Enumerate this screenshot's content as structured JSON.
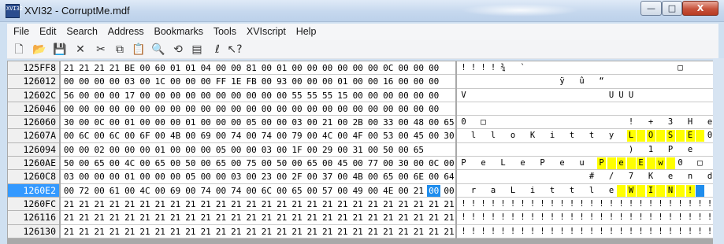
{
  "window": {
    "title": "XVI32 - CorruptMe.mdf",
    "icon_text": "XVI32",
    "minimize": "—",
    "maximize": "□",
    "close": "X"
  },
  "menu": [
    "File",
    "Edit",
    "Search",
    "Address",
    "Bookmarks",
    "Tools",
    "XVIscript",
    "Help"
  ],
  "toolbar": [
    {
      "name": "new-file-icon",
      "glyph": "🗋"
    },
    {
      "name": "open-folder-icon",
      "glyph": "📂"
    },
    {
      "name": "save-icon",
      "glyph": "💾"
    },
    {
      "name": "delete-icon",
      "glyph": "✕"
    },
    {
      "name": "cut-icon",
      "glyph": "✂"
    },
    {
      "name": "copy-icon",
      "glyph": "⧉"
    },
    {
      "name": "paste-icon",
      "glyph": "📋"
    },
    {
      "name": "find-icon",
      "glyph": "🔍"
    },
    {
      "name": "replace-icon",
      "glyph": "⟲"
    },
    {
      "name": "properties-icon",
      "glyph": "▤"
    },
    {
      "name": "script-icon",
      "glyph": "ℓ"
    },
    {
      "name": "help-pointer-icon",
      "glyph": "↖?"
    }
  ],
  "hex_view": {
    "selected_row": 9,
    "rows": [
      {
        "addr": "125FF8",
        "hex": [
          "21",
          "21",
          "21",
          "21",
          "BE",
          "00",
          "60",
          "01",
          "01",
          "04",
          "00",
          "00",
          "81",
          "00",
          "01",
          "00",
          "00",
          "00",
          "00",
          "00",
          "00",
          "0C",
          "00",
          "00",
          "00"
        ],
        "ascii": [
          "!",
          "!",
          "!",
          "!",
          "¾",
          "",
          "`",
          "",
          "",
          "",
          "",
          "",
          "",
          "",
          "",
          "",
          "",
          "",
          "",
          "",
          "",
          "",
          "□",
          "",
          ""
        ],
        "hl": []
      },
      {
        "addr": "126012",
        "hex": [
          "00",
          "00",
          "00",
          "00",
          "03",
          "00",
          "1C",
          "00",
          "00",
          "00",
          "FF",
          "1E",
          "FB",
          "00",
          "93",
          "00",
          "00",
          "00",
          "01",
          "00",
          "00",
          "16",
          "00",
          "00",
          "00"
        ],
        "ascii": [
          "",
          "",
          "",
          "",
          "",
          "",
          "",
          "",
          "",
          "",
          "ÿ",
          "",
          "û",
          "",
          "“",
          "",
          "",
          "",
          "",
          "",
          "",
          "",
          "",
          "",
          ""
        ],
        "hl": []
      },
      {
        "addr": "12602C",
        "hex": [
          "56",
          "00",
          "00",
          "00",
          "17",
          "00",
          "00",
          "00",
          "00",
          "00",
          "00",
          "00",
          "00",
          "00",
          "00",
          "55",
          "55",
          "55",
          "15",
          "00",
          "00",
          "00",
          "00",
          "00",
          "00"
        ],
        "ascii": [
          "V",
          "",
          "",
          "",
          "",
          "",
          "",
          "",
          "",
          "",
          "",
          "",
          "",
          "",
          "",
          "U",
          "U",
          "U",
          "",
          "",
          "",
          "",
          "",
          "",
          ""
        ],
        "hl": []
      },
      {
        "addr": "126046",
        "hex": [
          "00",
          "00",
          "00",
          "00",
          "00",
          "00",
          "00",
          "00",
          "00",
          "00",
          "00",
          "00",
          "00",
          "00",
          "00",
          "00",
          "00",
          "00",
          "00",
          "00",
          "00",
          "00",
          "00",
          "00",
          "00"
        ],
        "ascii": [
          "",
          "",
          "",
          "",
          "",
          "",
          "",
          "",
          "",
          "",
          "",
          "",
          "",
          "",
          "",
          "",
          "",
          "",
          "",
          "",
          "",
          "",
          "",
          "",
          ""
        ],
        "hl": []
      },
      {
        "addr": "126060",
        "hex": [
          "30",
          "00",
          "0C",
          "00",
          "01",
          "00",
          "00",
          "00",
          "01",
          "00",
          "00",
          "00",
          "05",
          "00",
          "00",
          "03",
          "00",
          "21",
          "00",
          "2B",
          "00",
          "33",
          "00",
          "48",
          "00",
          "65"
        ],
        "ascii": [
          "0",
          "",
          "□",
          "",
          "",
          "",
          "",
          "",
          "",
          "",
          "",
          "",
          "",
          "",
          "",
          "",
          "",
          "!",
          "",
          "+",
          "",
          "3",
          "",
          "H",
          "",
          "e"
        ],
        "hl": []
      },
      {
        "addr": "12607A",
        "hex": [
          "00",
          "6C",
          "00",
          "6C",
          "00",
          "6F",
          "00",
          "4B",
          "00",
          "69",
          "00",
          "74",
          "00",
          "74",
          "00",
          "79",
          "00",
          "4C",
          "00",
          "4F",
          "00",
          "53",
          "00",
          "45",
          "00",
          "30"
        ],
        "ascii": [
          "",
          "l",
          "",
          "l",
          "",
          "o",
          "",
          "K",
          "",
          "i",
          "",
          "t",
          "",
          "t",
          "",
          "y",
          "",
          "L",
          "",
          "O",
          "",
          "S",
          "",
          "E",
          "",
          "0"
        ],
        "hl": [
          17,
          18,
          19,
          20,
          21,
          22,
          23,
          24
        ]
      },
      {
        "addr": "126094",
        "hex": [
          "00",
          "00",
          "02",
          "00",
          "00",
          "00",
          "01",
          "00",
          "00",
          "00",
          "05",
          "00",
          "00",
          "03",
          "00",
          "1F",
          "00",
          "29",
          "00",
          "31",
          "00",
          "50",
          "00",
          "65"
        ],
        "ascii": [
          "",
          "",
          "",
          "",
          "",
          "",
          "",
          "",
          "",
          "",
          "",
          "",
          "",
          "",
          "",
          "",
          "",
          ")",
          "",
          "1",
          "",
          "P",
          "",
          "e"
        ],
        "hl": []
      },
      {
        "addr": "1260AE",
        "hex": [
          "50",
          "00",
          "65",
          "00",
          "4C",
          "00",
          "65",
          "00",
          "50",
          "00",
          "65",
          "00",
          "75",
          "00",
          "50",
          "00",
          "65",
          "00",
          "45",
          "00",
          "77",
          "00",
          "30",
          "00",
          "0C",
          "00"
        ],
        "ascii": [
          "P",
          "",
          "e",
          "",
          "L",
          "",
          "e",
          "",
          "P",
          "",
          "e",
          "",
          "u",
          "",
          "P",
          "",
          "e",
          "",
          "E",
          "",
          "w",
          "",
          "0",
          "",
          "□",
          ""
        ],
        "hl": [
          14,
          15,
          16,
          17,
          18,
          19,
          20,
          21
        ]
      },
      {
        "addr": "1260C8",
        "hex": [
          "03",
          "00",
          "00",
          "00",
          "01",
          "00",
          "00",
          "00",
          "05",
          "00",
          "00",
          "03",
          "00",
          "23",
          "00",
          "2F",
          "00",
          "37",
          "00",
          "4B",
          "00",
          "65",
          "00",
          "6E",
          "00",
          "64"
        ],
        "ascii": [
          "",
          "",
          "",
          "",
          "",
          "",
          "",
          "",
          "",
          "",
          "",
          "",
          "",
          "#",
          "",
          "/",
          "",
          "7",
          "",
          "K",
          "",
          "e",
          "",
          "n",
          "",
          "d"
        ],
        "hl": []
      },
      {
        "addr": "1260E2",
        "hex": [
          "00",
          "72",
          "00",
          "61",
          "00",
          "4C",
          "00",
          "69",
          "00",
          "74",
          "00",
          "74",
          "00",
          "6C",
          "00",
          "65",
          "00",
          "57",
          "00",
          "49",
          "00",
          "4E",
          "00",
          "21",
          "00",
          "00"
        ],
        "ascii": [
          "",
          "r",
          "",
          "a",
          "",
          "L",
          "",
          "i",
          "",
          "t",
          "",
          "t",
          "",
          "l",
          "",
          "e",
          "",
          "W",
          "",
          "I",
          "",
          "N",
          "",
          "!",
          "",
          ""
        ],
        "hl": [
          16,
          17,
          18,
          19,
          20,
          21,
          22,
          23,
          24
        ],
        "cursor": 24
      },
      {
        "addr": "1260FC",
        "hex": [
          "21",
          "21",
          "21",
          "21",
          "21",
          "21",
          "21",
          "21",
          "21",
          "21",
          "21",
          "21",
          "21",
          "21",
          "21",
          "21",
          "21",
          "21",
          "21",
          "21",
          "21",
          "21",
          "21",
          "21",
          "21",
          "21"
        ],
        "ascii": [
          "!",
          "!",
          "!",
          "!",
          "!",
          "!",
          "!",
          "!",
          "!",
          "!",
          "!",
          "!",
          "!",
          "!",
          "!",
          "!",
          "!",
          "!",
          "!",
          "!",
          "!",
          "!",
          "!",
          "!",
          "!",
          "!"
        ],
        "hl": []
      },
      {
        "addr": "126116",
        "hex": [
          "21",
          "21",
          "21",
          "21",
          "21",
          "21",
          "21",
          "21",
          "21",
          "21",
          "21",
          "21",
          "21",
          "21",
          "21",
          "21",
          "21",
          "21",
          "21",
          "21",
          "21",
          "21",
          "21",
          "21",
          "21",
          "21"
        ],
        "ascii": [
          "!",
          "!",
          "!",
          "!",
          "!",
          "!",
          "!",
          "!",
          "!",
          "!",
          "!",
          "!",
          "!",
          "!",
          "!",
          "!",
          "!",
          "!",
          "!",
          "!",
          "!",
          "!",
          "!",
          "!",
          "!",
          "!"
        ],
        "hl": []
      },
      {
        "addr": "126130",
        "hex": [
          "21",
          "21",
          "21",
          "21",
          "21",
          "21",
          "21",
          "21",
          "21",
          "21",
          "21",
          "21",
          "21",
          "21",
          "21",
          "21",
          "21",
          "21",
          "21",
          "21",
          "21",
          "21",
          "21",
          "21",
          "21",
          "21"
        ],
        "ascii": [
          "!",
          "!",
          "!",
          "!",
          "!",
          "!",
          "!",
          "!",
          "!",
          "!",
          "!",
          "!",
          "!",
          "!",
          "!",
          "!",
          "!",
          "!",
          "!",
          "!",
          "!",
          "!",
          "!",
          "!",
          "!",
          "!"
        ],
        "hl": []
      }
    ]
  }
}
